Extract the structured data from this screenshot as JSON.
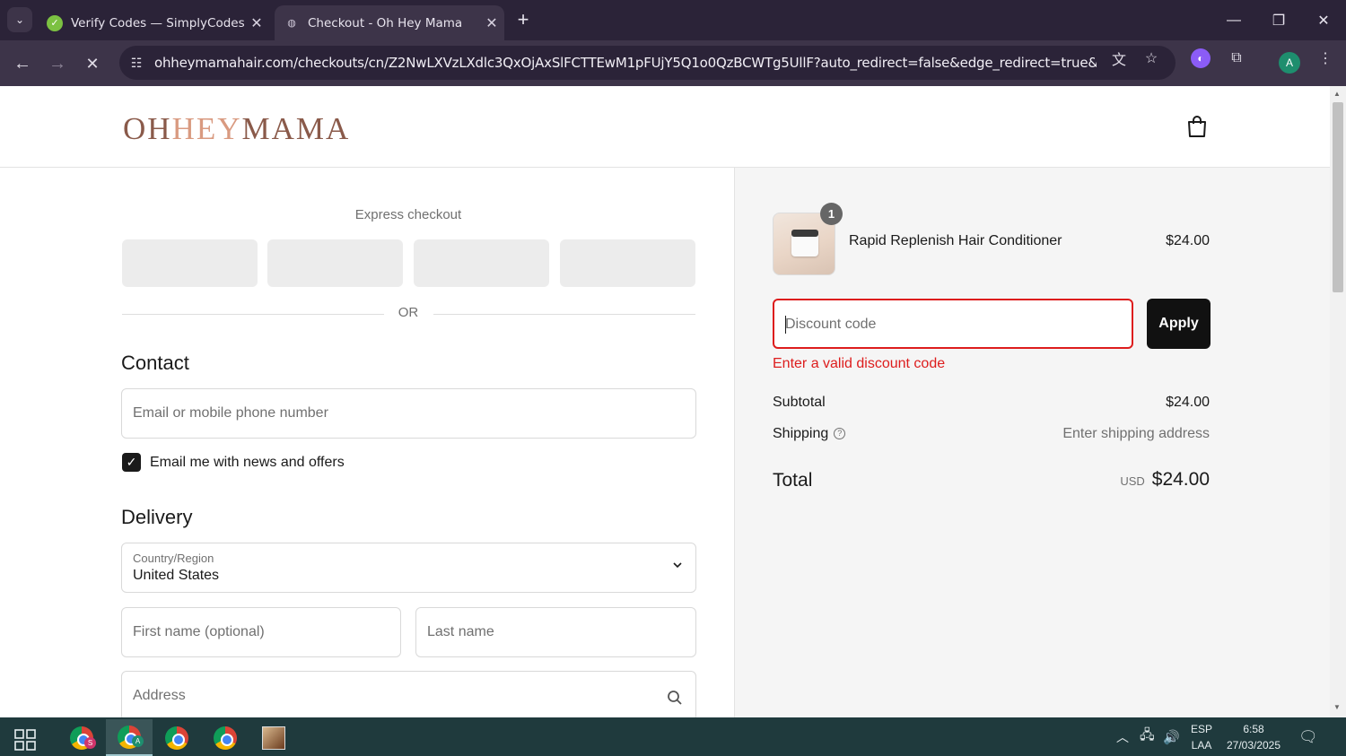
{
  "browser": {
    "tabs": [
      {
        "title": "Verify Codes — SimplyCodes",
        "active": false
      },
      {
        "title": "Checkout - Oh Hey Mama",
        "active": true
      }
    ],
    "url": "ohheymamahair.com/checkouts/cn/Z2NwLXVzLXdlc3QxOjAxSlFCTTEwM1pFUjY5Q1o0QzBCWTg5UllF?auto_redirect=false&edge_redirect=true&locale=e...",
    "profile_initial": "A"
  },
  "header": {
    "logo_oh": "OH",
    "logo_hey": "HEY",
    "logo_mama": "MAMA"
  },
  "checkout": {
    "express_title": "Express checkout",
    "or_label": "OR",
    "contact_heading": "Contact",
    "email_placeholder": "Email or mobile phone number",
    "newsletter_label": "Email me with news and offers",
    "newsletter_checked": true,
    "delivery_heading": "Delivery",
    "country_label": "Country/Region",
    "country_value": "United States",
    "first_name_placeholder": "First name (optional)",
    "last_name_placeholder": "Last name",
    "address_placeholder": "Address"
  },
  "summary": {
    "item": {
      "name": "Rapid Replenish Hair Conditioner",
      "price": "$24.00",
      "quantity": "1"
    },
    "discount_placeholder": "Discount code",
    "apply_label": "Apply",
    "discount_error": "Enter a valid discount code",
    "subtotal_label": "Subtotal",
    "subtotal_value": "$24.00",
    "shipping_label": "Shipping",
    "shipping_value": "Enter shipping address",
    "total_label": "Total",
    "total_currency": "USD",
    "total_value": "$24.00"
  },
  "taskbar": {
    "language": "ESP",
    "layout": "LAA",
    "time": "6:58",
    "date": "27/03/2025"
  },
  "colors": {
    "error": "#dd1d1d",
    "button": "#111111",
    "browser_frame": "#2b2338",
    "taskbar": "#1f3a3d"
  }
}
